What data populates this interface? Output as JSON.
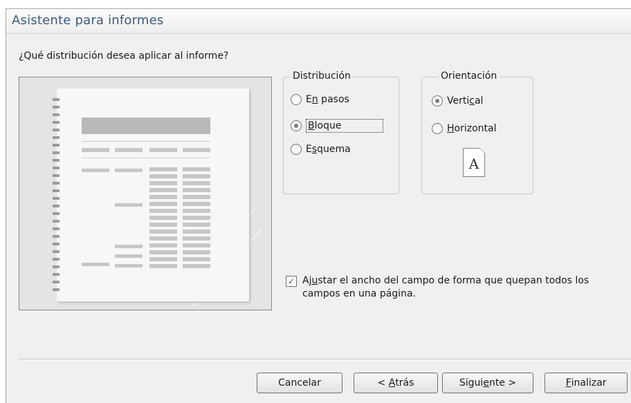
{
  "window": {
    "title": "Asistente para informes"
  },
  "question": "¿Qué distribución desea aplicar al informe?",
  "distribucion": {
    "legend": "Distribución",
    "options": [
      {
        "pre": "E",
        "key": "n",
        "post": " pasos",
        "checked": false
      },
      {
        "pre": "",
        "key": "B",
        "post": "loque",
        "checked": true
      },
      {
        "pre": "E",
        "key": "s",
        "post": "quema",
        "checked": false
      }
    ]
  },
  "orientacion": {
    "legend": "Orientación",
    "options": [
      {
        "pre": "Verti",
        "key": "c",
        "post": "al",
        "checked": true
      },
      {
        "pre": "",
        "key": "H",
        "post": "orizontal",
        "checked": false
      }
    ],
    "icon_letter": "A"
  },
  "adjust": {
    "checked": true,
    "pre": "Aj",
    "key": "u",
    "post": "star el ancho del campo de forma que quepan todos los campos en una página."
  },
  "buttons": {
    "cancel": {
      "pre": "Cancelar",
      "key": "",
      "post": ""
    },
    "back": {
      "pre": "< ",
      "key": "A",
      "post": "trás"
    },
    "next": {
      "pre": "Sigui",
      "key": "e",
      "post": "nte >"
    },
    "finish": {
      "pre": "",
      "key": "F",
      "post": "inalizar"
    }
  }
}
